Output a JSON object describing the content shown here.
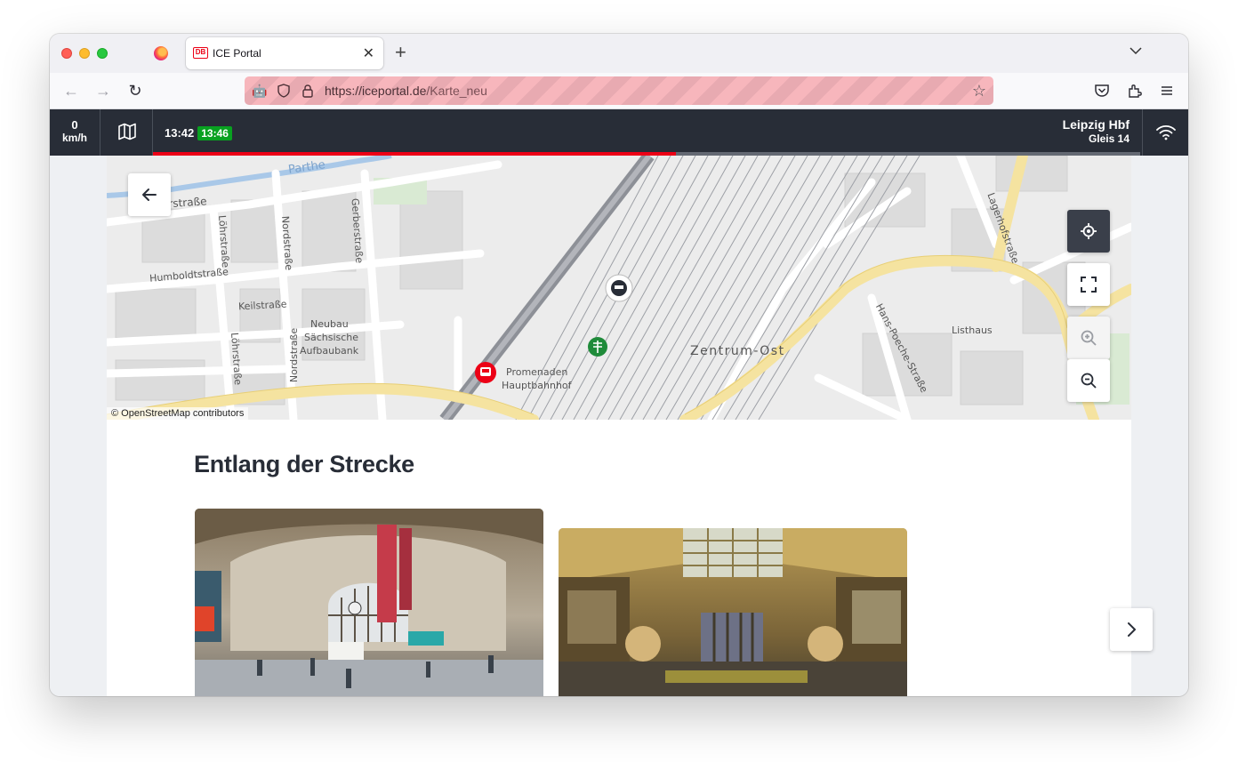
{
  "browser": {
    "tab_title": "ICE Portal",
    "tab_favicon_text": "DB",
    "url_scheme_host": "https://iceportal.de",
    "url_path": "/Karte_neu",
    "new_tab_label": "+",
    "close_tab_label": "✕"
  },
  "ice": {
    "speed_value": "0",
    "speed_unit": "km/h",
    "time_scheduled": "13:42",
    "time_actual": "13:46",
    "station_name": "Leipzig Hbf",
    "station_platform": "Gleis 14",
    "progress_percent": 53,
    "progress_color": "#ec0016",
    "delay_color": "#08a120"
  },
  "map": {
    "attribution": "© OpenStreetMap contributors",
    "labels": {
      "parthe": "Parthe",
      "gerberstrasse_top": "erstraße",
      "loehrstrasse_1": "Löhrstraße",
      "nordstrasse_1": "Nordstraße",
      "gerberstrasse": "Gerberstraße",
      "humboldtstrasse": "Humboldtstraße",
      "keilstrasse": "Keilstraße",
      "neubau_1": "Neubau",
      "neubau_2": "Sächsische",
      "neubau_3": "Aufbaubank",
      "loehrstrasse_2": "Löhrstraße",
      "nordstrasse_2": "Nordstraße",
      "promenaden_1": "Promenaden",
      "promenaden_2": "Hauptbahnhof",
      "zentrum_ost": "Zentrum-Ost",
      "lagerhofstrasse": "Lagerhofstraße",
      "hans_poeche": "Hans-Poeche-Straße",
      "listhaus": "Listhaus"
    }
  },
  "section": {
    "title": "Entlang der Strecke"
  }
}
